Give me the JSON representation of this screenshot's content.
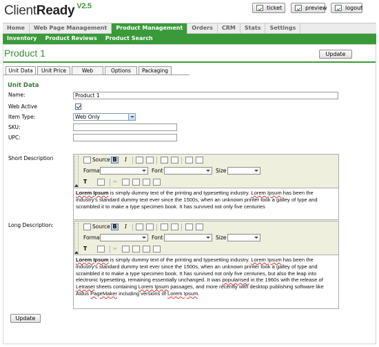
{
  "app": {
    "name_regular": "Client",
    "name_bold": "Ready",
    "version": "V2.5"
  },
  "header_buttons": {
    "ticket": "ticket",
    "preview": "preview",
    "logout": "logout"
  },
  "nav": {
    "items": [
      {
        "label": "Home"
      },
      {
        "label": "Web Page Management"
      },
      {
        "label": "Product Management",
        "active": true
      },
      {
        "label": "Orders"
      },
      {
        "label": "CRM"
      },
      {
        "label": "Stats"
      },
      {
        "label": "Settings"
      }
    ]
  },
  "subnav": {
    "items": [
      {
        "label": "Inventory"
      },
      {
        "label": "Product Reviews"
      },
      {
        "label": "Product Search"
      }
    ]
  },
  "page": {
    "title": "Product 1",
    "update_label": "Update"
  },
  "tabs": [
    {
      "label": "Unit Data",
      "active": true
    },
    {
      "label": "Unit Price"
    },
    {
      "label": "Web"
    },
    {
      "label": "Options"
    },
    {
      "label": "Packaging"
    }
  ],
  "form": {
    "section_title": "Unit Data",
    "name": {
      "label": "Name:",
      "value": "Product 1"
    },
    "web_active": {
      "label": "Web Active",
      "checked": true
    },
    "item_type": {
      "label": "Item Type:",
      "value": "Web Only"
    },
    "sku": {
      "label": "SKU:",
      "value": ""
    },
    "upc": {
      "label": "UPC:",
      "value": ""
    },
    "short_description": {
      "label": "Short Description"
    },
    "long_description": {
      "label": "Long Description:"
    }
  },
  "editor_toolbar": {
    "source": "Source",
    "bold": "B",
    "italic": "I",
    "format": "Format",
    "font": "Font",
    "size": "Size",
    "text_color": "T"
  },
  "short_text": {
    "w1": "Lorem Ipsum",
    "t1": " is simply dummy text of the printing and typesetting industry. ",
    "w2": "Lorem Ipsum",
    "t2": " has been the industry's standard dummy text ever since the 1500s, when an unknown printer took a galley of type and scrambled it to make a type specimen book. It has survived not only five centuries"
  },
  "long_text": {
    "w1": "Lorem Ipsum",
    "t1": " is simply dummy text of the printing and typesetting industry. ",
    "w2": "Lorem Ipsum",
    "t2": " has been the industry's standard dummy text ever since the 1500s, when an unknown printer took a galley of type and scrambled it to make a type specimen book. It has survived not only five centuries, but also the leap into electronic typesetting, remaining essentially unchanged. It was ",
    "w3": "popularised",
    "t3": " in the 1960s with the release of ",
    "w4": "Letraset",
    "t4": " sheets containing ",
    "w5": "Lorem Ipsum",
    "t5": " passages, and more recently with desktop publishing software like Aldus ",
    "w6": "PageMaker",
    "t6": " including versions of ",
    "w7": "Lorem Ipsum",
    "t7": "."
  },
  "footer": {
    "update_label": "Update"
  },
  "colors": {
    "accent": "#3a9a3a",
    "title": "#3a8a3a",
    "editor_toolbar": "#efefde"
  },
  "icons": [
    "check-icon",
    "source-icon",
    "ordered-list-icon",
    "unordered-list-icon",
    "link-icon",
    "unlink-icon",
    "image-icon",
    "table-icon",
    "text-color-icon",
    "background-color-icon",
    "cut-icon",
    "copy-icon",
    "paste-icon",
    "paste-text-icon",
    "paste-word-icon"
  ]
}
